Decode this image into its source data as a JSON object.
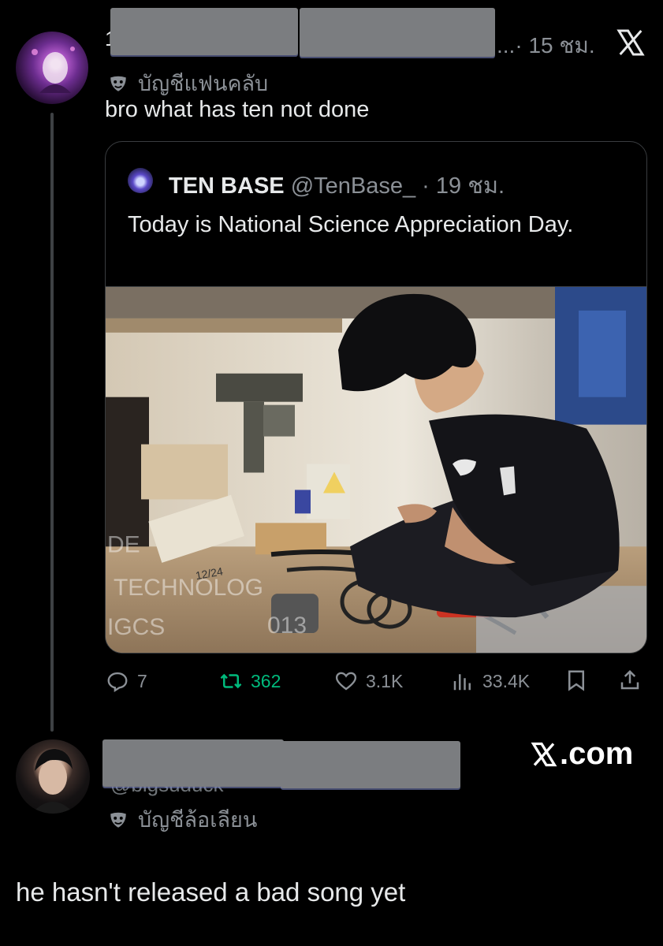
{
  "post": {
    "name_peek": "1",
    "time": "...· 15 ชม.",
    "account_label": "บัญชีแฟนคลับ",
    "text": "bro what has ten not done"
  },
  "quote": {
    "author_name": "TEN BASE",
    "author_handle": "@TenBase_ · 19 ชม.",
    "text": "Today is National Science Appreciation Day.",
    "photo_text": [
      "DE",
      "TECHNOLOG",
      "IGCS",
      "013",
      "12/24"
    ]
  },
  "actions": {
    "replies": "7",
    "reposts": "362",
    "likes": "3.1K",
    "views": "33.4K"
  },
  "reply": {
    "handle_peek": "@bigsuduck",
    "account_label": "บัญชีล้อเลียน",
    "text": "he hasn't released a bad song yet"
  },
  "watermark": {
    "text": ".com"
  },
  "colors": {
    "background": "#000000",
    "text": "#e7e9ea",
    "muted": "#8b9096",
    "repost_green": "#00ba7c",
    "redaction": "#7b7d80"
  },
  "icons": [
    "x-logo-icon",
    "mask-icon",
    "reply-icon",
    "repost-icon",
    "like-icon",
    "views-icon",
    "bookmark-icon",
    "share-icon"
  ]
}
